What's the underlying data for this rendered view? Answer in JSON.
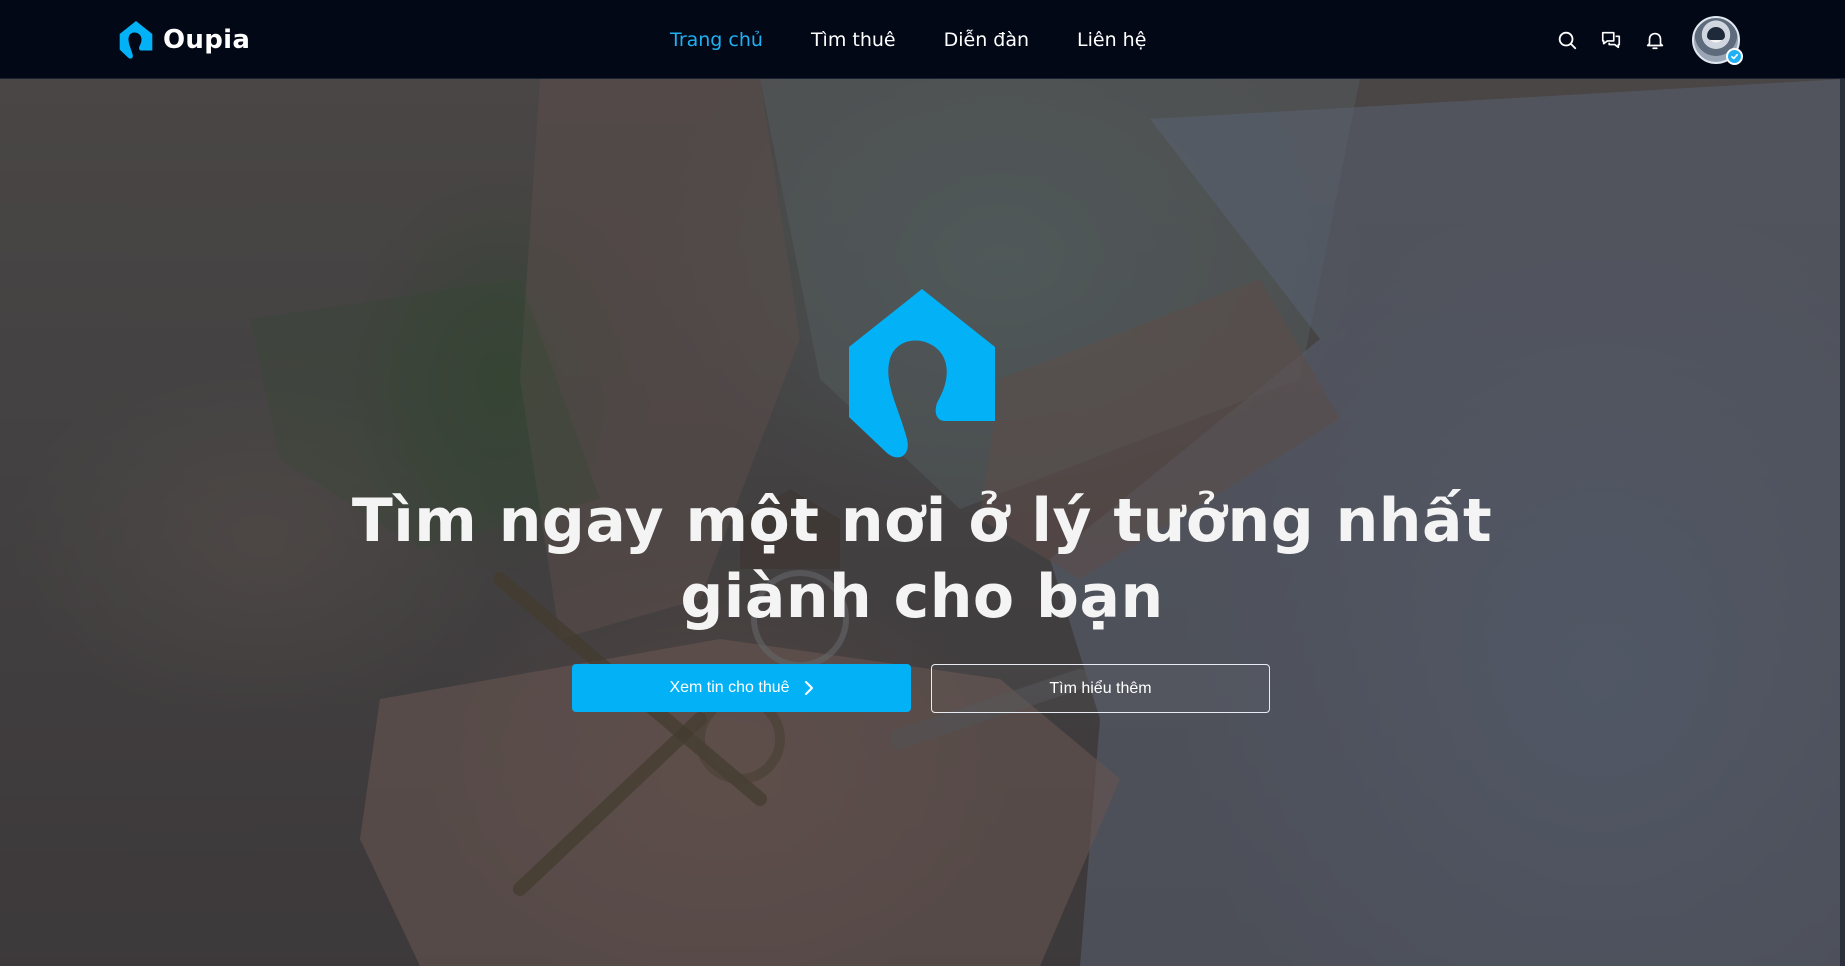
{
  "app": {
    "brand_name": "Oupia",
    "accent_color": "#03b2f6"
  },
  "nav": {
    "items": [
      {
        "label": "Trang chủ",
        "active": true
      },
      {
        "label": "Tìm thuê",
        "active": false
      },
      {
        "label": "Diễn đàn",
        "active": false
      },
      {
        "label": "Liên hệ",
        "active": false
      }
    ]
  },
  "actions": {
    "icons": [
      "search-icon",
      "chat-icon",
      "bell-icon"
    ],
    "avatar_verified": true
  },
  "hero": {
    "title_line1": "Tìm ngay một nơi ở lý tưởng nhất",
    "title_line2": "giành cho bạn",
    "primary_button": "Xem tin cho thuê",
    "secondary_button": "Tìm hiểu thêm",
    "background_image": "hands-holding-house-keys"
  }
}
